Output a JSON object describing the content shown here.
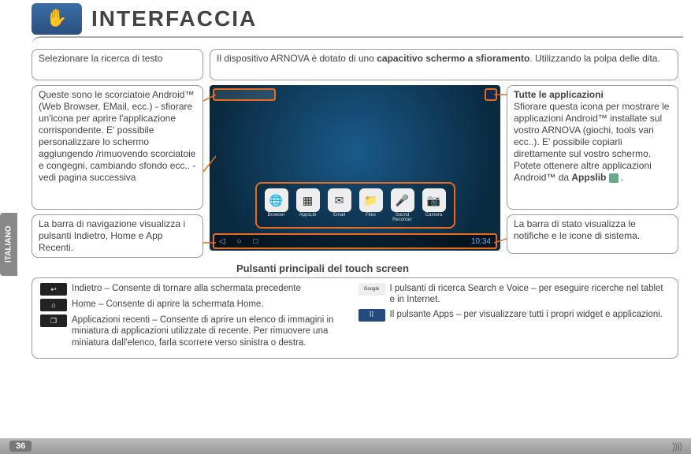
{
  "header": {
    "title": "INTERFACCIA"
  },
  "sidetab": "ITALIANO",
  "intro": {
    "text_before": "Il dispositivo ARNOVA è dotato di uno ",
    "bold": "capacitivo schermo a sfioramento",
    "text_after": ". Utilizzando la polpa delle dita."
  },
  "callouts": {
    "search_text": "Selezionare la ricerca di testo",
    "shortcuts": "Queste sono le scorciatoie Android™ (Web Browser, EMail, ecc.) - sfiorare un'icona per aprire l'applicazione corrispondente. E' possibile personalizzare lo schermo aggiungendo /rimuovendo scorciatoie e congegni, cambiando sfondo ecc.. - vedi pagina successiva",
    "navbar": "La barra di navigazione visualizza i pulsanti Indietro, Home e App Recenti.",
    "allapps_title": "Tutte le applicazioni",
    "allapps_body_before": "Sfiorare questa icona per mostrare le applicazioni Android™ installate sul vostro ARNOVA (giochi, tools vari ecc..). E' possibile copiarli direttamente sul vostro schermo. Potete ottenere altre applicazioni Android™ da ",
    "allapps_body_bold": "Appslib",
    "statusbar": "La barra di stato visualizza le notifiche e le icone di sistema."
  },
  "screenshot": {
    "google_label": "Google",
    "dock": [
      "Browser",
      "AppsLib",
      "Email",
      "Files",
      "Sound Recorder",
      "Camera"
    ],
    "time": "10:34"
  },
  "subhead": "Pulsanti principali del touch screen",
  "bottom": {
    "back": "Indietro – Consente di tornare alla schermata precedente",
    "home": "Home – Consente di aprire la schermata Home.",
    "recent": "Applicazioni recenti – Consente di aprire un elenco di immagini in miniatura di applicazioni utilizzate di recente. Per rimuovere una miniatura dall'elenco, farla scorrere verso sinistra o destra.",
    "search": "I pulsanti di ricerca Search e Voice – per eseguire ricerche nel tablet e in Internet.",
    "apps": "Il pulsante Apps – per visualizzare tutti i propri widget e applicazioni."
  },
  "page_number": "36"
}
